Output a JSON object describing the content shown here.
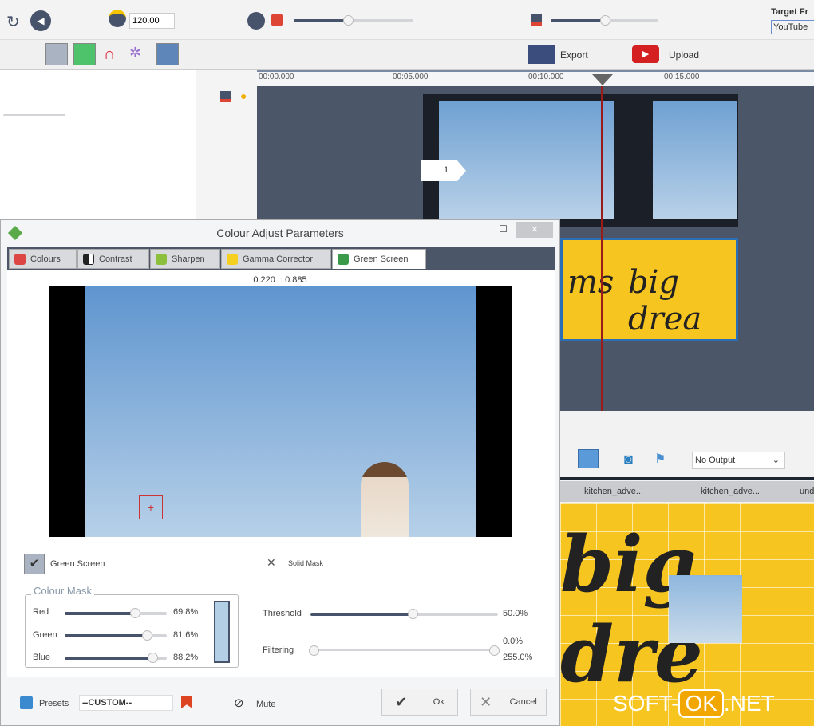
{
  "toolbar": {
    "tempo_value": "120.00",
    "target_label": "Target Fr",
    "target_value": "YouTube",
    "export_label": "Export",
    "upload_label": "Upload"
  },
  "timeline": {
    "ruler": [
      "00:00.000",
      "00:05.000",
      "00:10.000",
      "00:15.000"
    ],
    "track_badge": "1",
    "text_clip": "big dreams",
    "text_clip_left": "ms",
    "text_clip_right": "big drea"
  },
  "dialog": {
    "title": "Colour Adjust Parameters",
    "tabs": [
      "Colours",
      "Contrast",
      "Sharpen",
      "Gamma Corrector",
      "Green Screen"
    ],
    "active_tab": 4,
    "coords": "0.220 :: 0.885",
    "green_screen_label": "Green Screen",
    "green_screen_checked": true,
    "solid_mask_label": "Solid Mask",
    "colour_mask_title": "Colour Mask",
    "mask": [
      {
        "label": "Red",
        "value": "69.8%",
        "fraction": 0.698
      },
      {
        "label": "Green",
        "value": "81.6%",
        "fraction": 0.816
      },
      {
        "label": "Blue",
        "value": "88.2%",
        "fraction": 0.882
      }
    ],
    "mask_color": "#b2cfe6",
    "threshold": {
      "label": "Threshold",
      "value": "50.0%",
      "fraction": 0.5
    },
    "filtering": {
      "label": "Filtering",
      "value_low": "0.0%",
      "value_high": "255.0%"
    },
    "presets_label": "Presets",
    "presets_value": "--CUSTOM--",
    "mute_label": "Mute",
    "ok_label": "Ok",
    "cancel_label": "Cancel"
  },
  "preview_panel": {
    "output_select": "No Output",
    "tabs": [
      "kitchen_adve...",
      "kitchen_adve...",
      "und"
    ],
    "preview_text": "big dre"
  },
  "watermark": {
    "left": "SOFT-",
    "box": "OK",
    ".net": ".NET"
  }
}
